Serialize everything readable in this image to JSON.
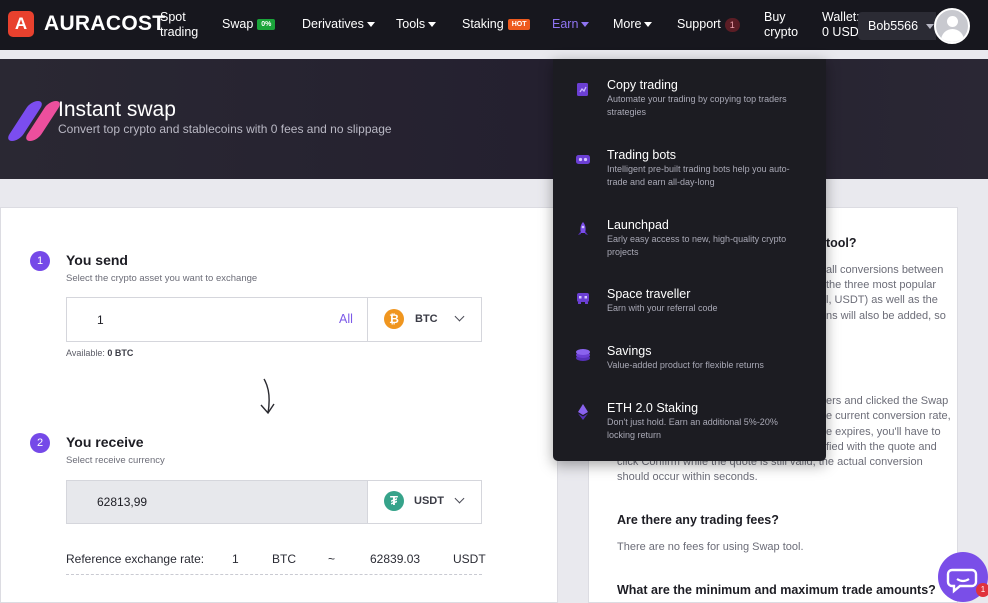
{
  "nav": {
    "brand": "AURACOST",
    "spot_l1": "Spot",
    "spot_l2": "trading",
    "swap": "Swap",
    "swap_badge": "0%",
    "derivatives": "Derivatives",
    "tools": "Tools",
    "staking": "Staking",
    "staking_badge": "HOT",
    "earn": "Earn",
    "more": "More",
    "support": "Support",
    "support_count": "1",
    "buy_l1": "Buy",
    "buy_l2": "crypto",
    "wallet_l1": "Wallet:",
    "wallet_l2": "0 USD",
    "user": "Bob5566"
  },
  "hero": {
    "title": "Instant swap",
    "subtitle": "Convert top crypto and stablecoins with 0 fees and no slippage"
  },
  "send": {
    "step": "1",
    "title": "You send",
    "hint": "Select the crypto asset you want to exchange",
    "amount": "1",
    "all_label": "All",
    "currency": "BTC",
    "available_label": "Available:",
    "available_value": "0 BTC"
  },
  "receive": {
    "step": "2",
    "title": "You receive",
    "hint": "Select receive currency",
    "amount": "62813,99",
    "currency": "USDT"
  },
  "reference": {
    "label": "Reference exchange rate:",
    "from_amount": "1",
    "from_currency": "BTC",
    "approx": "~",
    "to_amount": "62839.03",
    "to_currency": "USDT"
  },
  "faq_fragments": {
    "q1_tail": "tool?",
    "a1_lines": [
      "all conversions between",
      "the three most popular",
      "l, USDT) as well as the",
      "ns will also be added, so"
    ],
    "a2_lines": [
      "ers and clicked the Swap",
      "e current conversion rate,",
      "e expires, you'll have to",
      "fied with the quote and",
      "click Confirm while the quote is still valid, the actual conversion",
      "should occur within seconds."
    ],
    "q2": "Are there any trading fees?",
    "a3": "There are no fees for using Swap tool.",
    "q3": "What are the minimum and maximum trade amounts?"
  },
  "earn_menu": [
    {
      "title": "Copy trading",
      "desc": "Automate your trading by copying top traders strategies",
      "icon": "copy-trading-icon"
    },
    {
      "title": "Trading bots",
      "desc": "Intelligent pre-built trading bots help you auto-trade and earn all-day-long",
      "icon": "robot-icon"
    },
    {
      "title": "Launchpad",
      "desc": "Early easy access to new, high-quality crypto projects",
      "icon": "rocket-icon"
    },
    {
      "title": "Space traveller",
      "desc": "Earn with your referral code",
      "icon": "space-invader-icon"
    },
    {
      "title": "Savings",
      "desc": "Value-added product for flexible returns",
      "icon": "coin-stack-icon"
    },
    {
      "title": "ETH 2.0 Staking",
      "desc": "Don't just hold. Earn an additional 5%-20% locking return",
      "icon": "ethereum-icon"
    }
  ],
  "chat": {
    "badge": "1"
  },
  "colors": {
    "accent": "#7549e8",
    "nav_bg": "#17171e",
    "menu_bg": "#1c1c22",
    "brand_red": "#e8412e"
  }
}
